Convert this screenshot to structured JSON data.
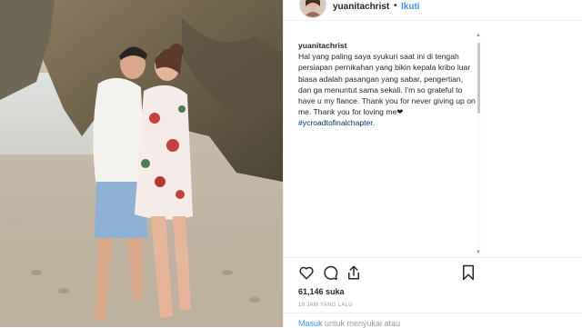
{
  "post": {
    "username": "yuanitachrist",
    "separator": "•",
    "follow_label": "Ikuti"
  },
  "caption": {
    "username": "yuanitachrist",
    "text": "Hal yang paling saya syukuri saat ini di tengah persiapan pernikahan yang bikin kepala kribo luar biasa adalah pasangan yang sabar, pengertian, dan ga menuntut sama sekali. I'm so grateful to have u my fiance. Thank you for never giving up on me. Thank you for loving me❤",
    "hashtag": "#ycroadtofinalchapter."
  },
  "actions": {
    "like_icon": "heart-icon",
    "comment_icon": "comment-icon",
    "share_icon": "share-icon",
    "save_icon": "bookmark-icon"
  },
  "stats": {
    "likes": "61,146 suka",
    "time": "19 JAM YANG LALU"
  },
  "footer": {
    "login_link": "Masuk",
    "login_rest": " untuk menyukai atau"
  }
}
